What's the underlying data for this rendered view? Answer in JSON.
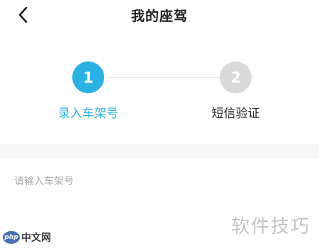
{
  "header": {
    "title": "我的座驾",
    "back_icon": "chevron-left-icon"
  },
  "steps": [
    {
      "number": "1",
      "label": "录入车架号",
      "state": "active",
      "color": "#2bb1e3"
    },
    {
      "number": "2",
      "label": "短信验证",
      "state": "inactive",
      "color": "#d9d9d9"
    }
  ],
  "form": {
    "vin_placeholder": "请输入车架号",
    "vin_value": ""
  },
  "watermark": {
    "text": "软件技巧"
  },
  "logo": {
    "mark": "php",
    "text": "中文网"
  }
}
